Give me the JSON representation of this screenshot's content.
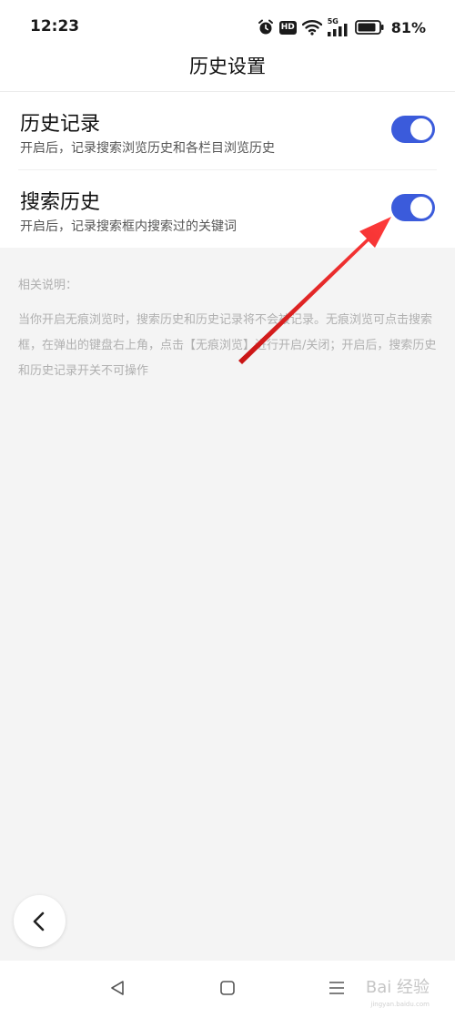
{
  "status_bar": {
    "time": "12:23",
    "icons": [
      "alarm-icon",
      "hd-icon",
      "wifi-icon",
      "5g-signal-icon",
      "battery-icon"
    ],
    "hd": "HD",
    "network": "5G",
    "battery": "81%"
  },
  "header": {
    "title": "历史设置"
  },
  "settings": {
    "items": [
      {
        "title": "历史记录",
        "description": "开启后，记录搜索浏览历史和各栏目浏览历史",
        "enabled": true
      },
      {
        "title": "搜索历史",
        "description": "开启后，记录搜索框内搜索过的关键词",
        "enabled": true
      }
    ]
  },
  "notes": {
    "title": "相关说明：",
    "body": "当你开启无痕浏览时，搜索历史和历史记录将不会被记录。无痕浏览可点击搜索框，在弹出的键盘右上角，点击【无痕浏览】进行开启/关闭；开启后，搜索历史和历史记录开关不可操作"
  },
  "floating": {
    "back_icon": "chevron-left-icon"
  },
  "nav_bar": {
    "icons": [
      "nav-back-icon",
      "nav-home-icon",
      "nav-menu-icon"
    ],
    "watermark": "Bai 经验",
    "watermark_sub": "jingyan.baidu.com"
  },
  "colors": {
    "toggle_on": "#3b5bdb",
    "annotation_arrow": "#e02020",
    "page_bg": "#f4f4f4"
  }
}
